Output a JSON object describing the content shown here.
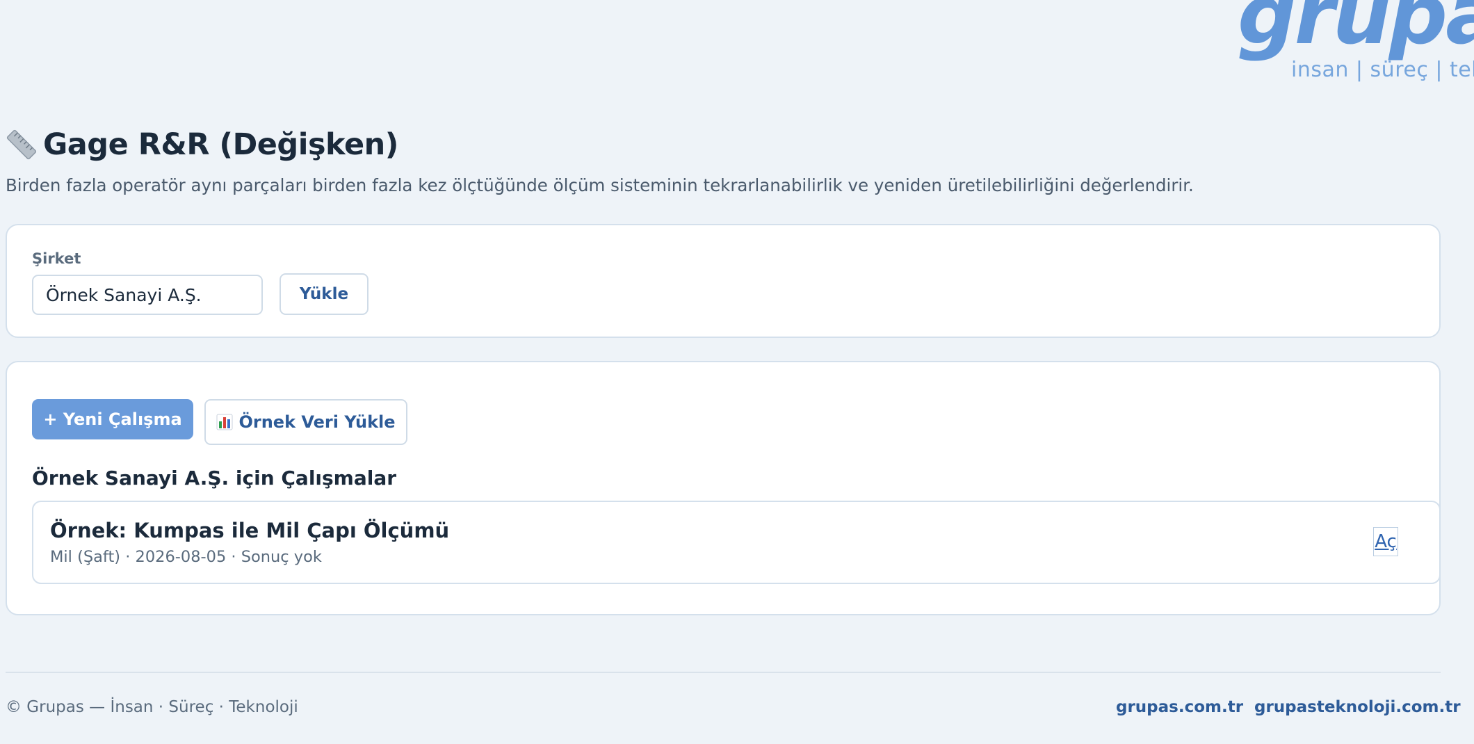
{
  "logo": {
    "wordmark": "grupas",
    "tagline": "insan | süreç | teknoloji"
  },
  "header": {
    "title_icon": "ruler-icon",
    "title": "Gage R&R (Değişken)",
    "description": "Birden fazla operatör aynı parçaları birden fazla kez ölçtüğünde ölçüm sisteminin tekrarlanabilirlik ve yeniden üretilebilirliğini değerlendirir."
  },
  "company": {
    "label": "Şirket",
    "value": "Örnek Sanayi A.Ş.",
    "load_button": "Yükle"
  },
  "studies": {
    "new_button": "+ Yeni Çalışma",
    "sample_button_icon": "bar-chart-icon",
    "sample_button": "Örnek Veri Yükle",
    "section_title": "Örnek Sanayi A.Ş. için Çalışmalar",
    "items": [
      {
        "name": "Örnek: Kumpas ile Mil Çapı Ölçümü",
        "meta": "Mil (Şaft) · 2026-08-05 · Sonuç yok",
        "open_label": "Aç"
      }
    ]
  },
  "footer": {
    "copyright": "© Grupas — İnsan · Süreç · Teknoloji",
    "links": [
      "grupas.com.tr",
      "grupasteknoloji.com.tr"
    ]
  },
  "colors": {
    "background": "#eef3f8",
    "primary": "#6a9bdb",
    "link": "#2d5b98",
    "logo": "#6196d8"
  }
}
